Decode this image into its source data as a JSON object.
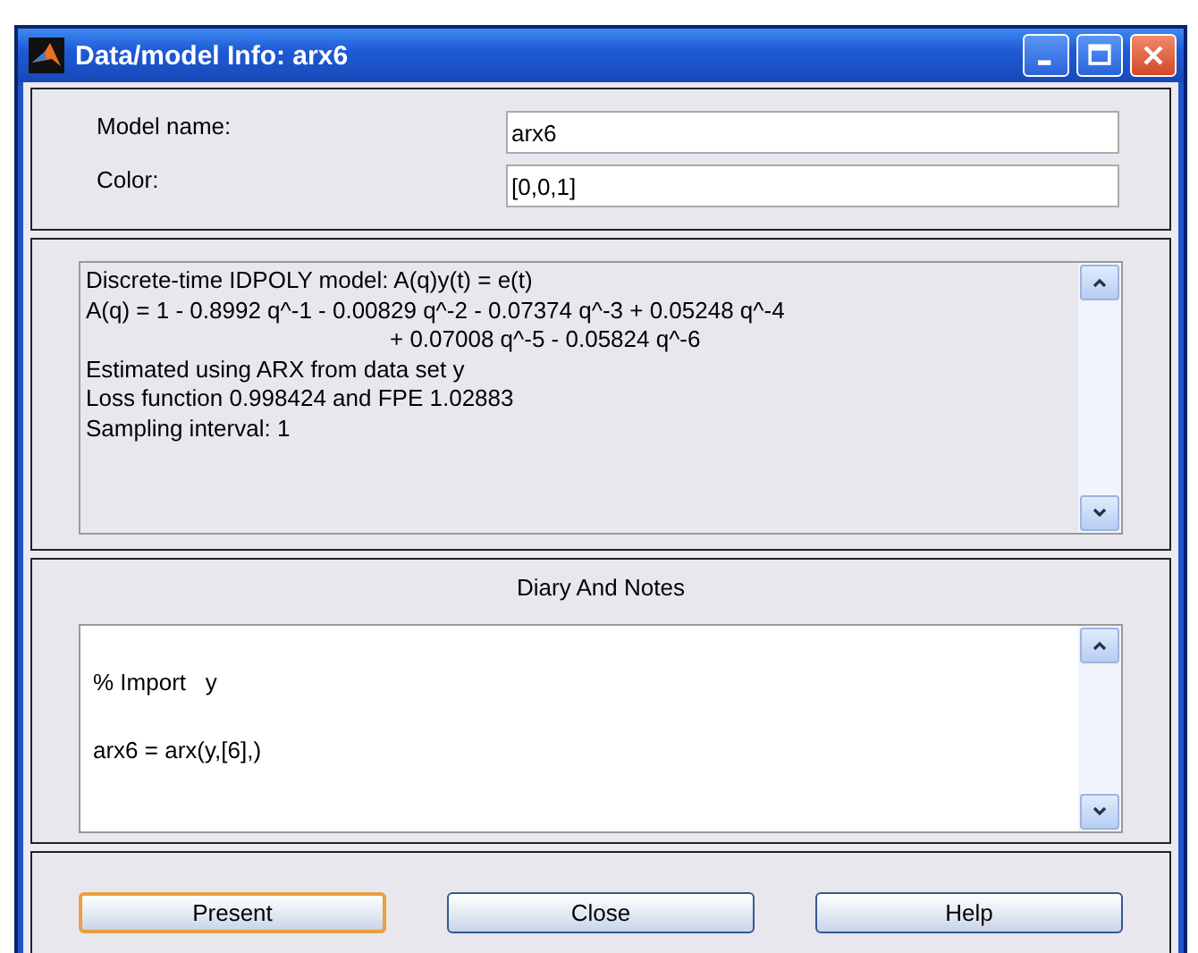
{
  "window": {
    "title": "Data/model Info: arx6"
  },
  "fields": [
    {
      "label": "Model name:",
      "value": "arx6"
    },
    {
      "label": "Color:",
      "value": "[0,0,1]"
    }
  ],
  "model_text": {
    "lines": [
      {
        "kind": "line",
        "text": "Discrete-time IDPOLY model: A(q)y(t) = e(t)"
      },
      {
        "kind": "line",
        "text": "A(q) = 1 - 0.8992 q^-1 - 0.00829 q^-2 - 0.07374 q^-3 + 0.05248 q^-4"
      },
      {
        "kind": "continuation",
        "text": "+ 0.07008 q^-5 - 0.05824 q^-6"
      },
      {
        "kind": "line",
        "text": "Estimated using ARX from data set y"
      },
      {
        "kind": "line",
        "text": "Loss function 0.998424 and FPE 1.02883"
      },
      {
        "kind": "line",
        "text": "Sampling interval: 1"
      }
    ]
  },
  "diary": {
    "title": "Diary And Notes",
    "lines": [
      "% Import   y",
      "arx6 = arx(y,[6],)"
    ]
  },
  "buttons": [
    {
      "label": "Present",
      "focused": true
    },
    {
      "label": "Close",
      "focused": false
    },
    {
      "label": "Help",
      "focused": false
    }
  ]
}
